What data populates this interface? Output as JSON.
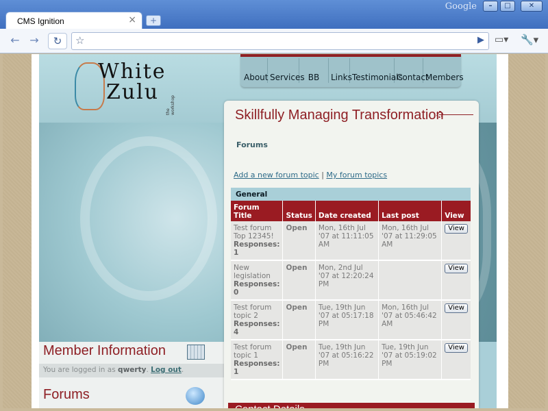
{
  "browser": {
    "tab_title": "CMS Ignition",
    "google_label": "Google",
    "address_placeholder": ""
  },
  "site": {
    "logo": {
      "word1": "White",
      "word2": "Zulu",
      "tagline": "the workshop"
    },
    "nav": [
      "About",
      "Services",
      "BB BEE",
      "Links",
      "Testimonials",
      "Contact",
      "Members"
    ]
  },
  "sidebar": {
    "member_title": "Member Information",
    "logged_in_prefix": "You are logged in as",
    "username": "qwerty",
    "logout_label": "Log out",
    "forums_title": "Forums"
  },
  "main": {
    "title": "Skillfully Managing Transformation",
    "subtitle": "Forums",
    "add_topic_label": "Add a new forum topic",
    "separator": "|",
    "my_topics_label": "My forum topics",
    "section": "General",
    "columns": [
      "Forum Title",
      "Status",
      "Date created",
      "Last post",
      "View"
    ],
    "rows": [
      {
        "title": "Test forum Top 12345!",
        "responses_label": "Responses:",
        "responses": "1",
        "status": "Open",
        "created": "Mon, 16th Jul '07 at 11:11:05 AM",
        "last_post": "Mon, 16th Jul '07 at 11:29:05 AM",
        "view": "View"
      },
      {
        "title": "New legislation",
        "responses_label": "Responses:",
        "responses": "0",
        "status": "Open",
        "created": "Mon, 2nd Jul '07 at 12:20:24 PM",
        "last_post": "",
        "view": "View"
      },
      {
        "title": "Test forum topic 2",
        "responses_label": "Responses:",
        "responses": "4",
        "status": "Open",
        "created": "Tue, 19th Jun '07 at 05:17:18 PM",
        "last_post": "Mon, 16th Jul '07 at 05:46:42 AM",
        "view": "View"
      },
      {
        "title": "Test forum topic 1",
        "responses_label": "Responses:",
        "responses": "1",
        "status": "Open",
        "created": "Tue, 19th Jun '07 at 05:16:22 PM",
        "last_post": "Tue, 19th Jun '07 at 05:19:02 PM",
        "view": "View"
      }
    ],
    "contact_title": "Contact Details"
  },
  "colors": {
    "brand_red": "#9a1b22",
    "teal": "#a9cfd8"
  },
  "icons": [
    "back-icon",
    "forward-icon",
    "reload-icon",
    "star-icon",
    "go-icon",
    "page-menu-icon",
    "wrench-icon",
    "calendar-icon",
    "chat-bubble-icon"
  ]
}
